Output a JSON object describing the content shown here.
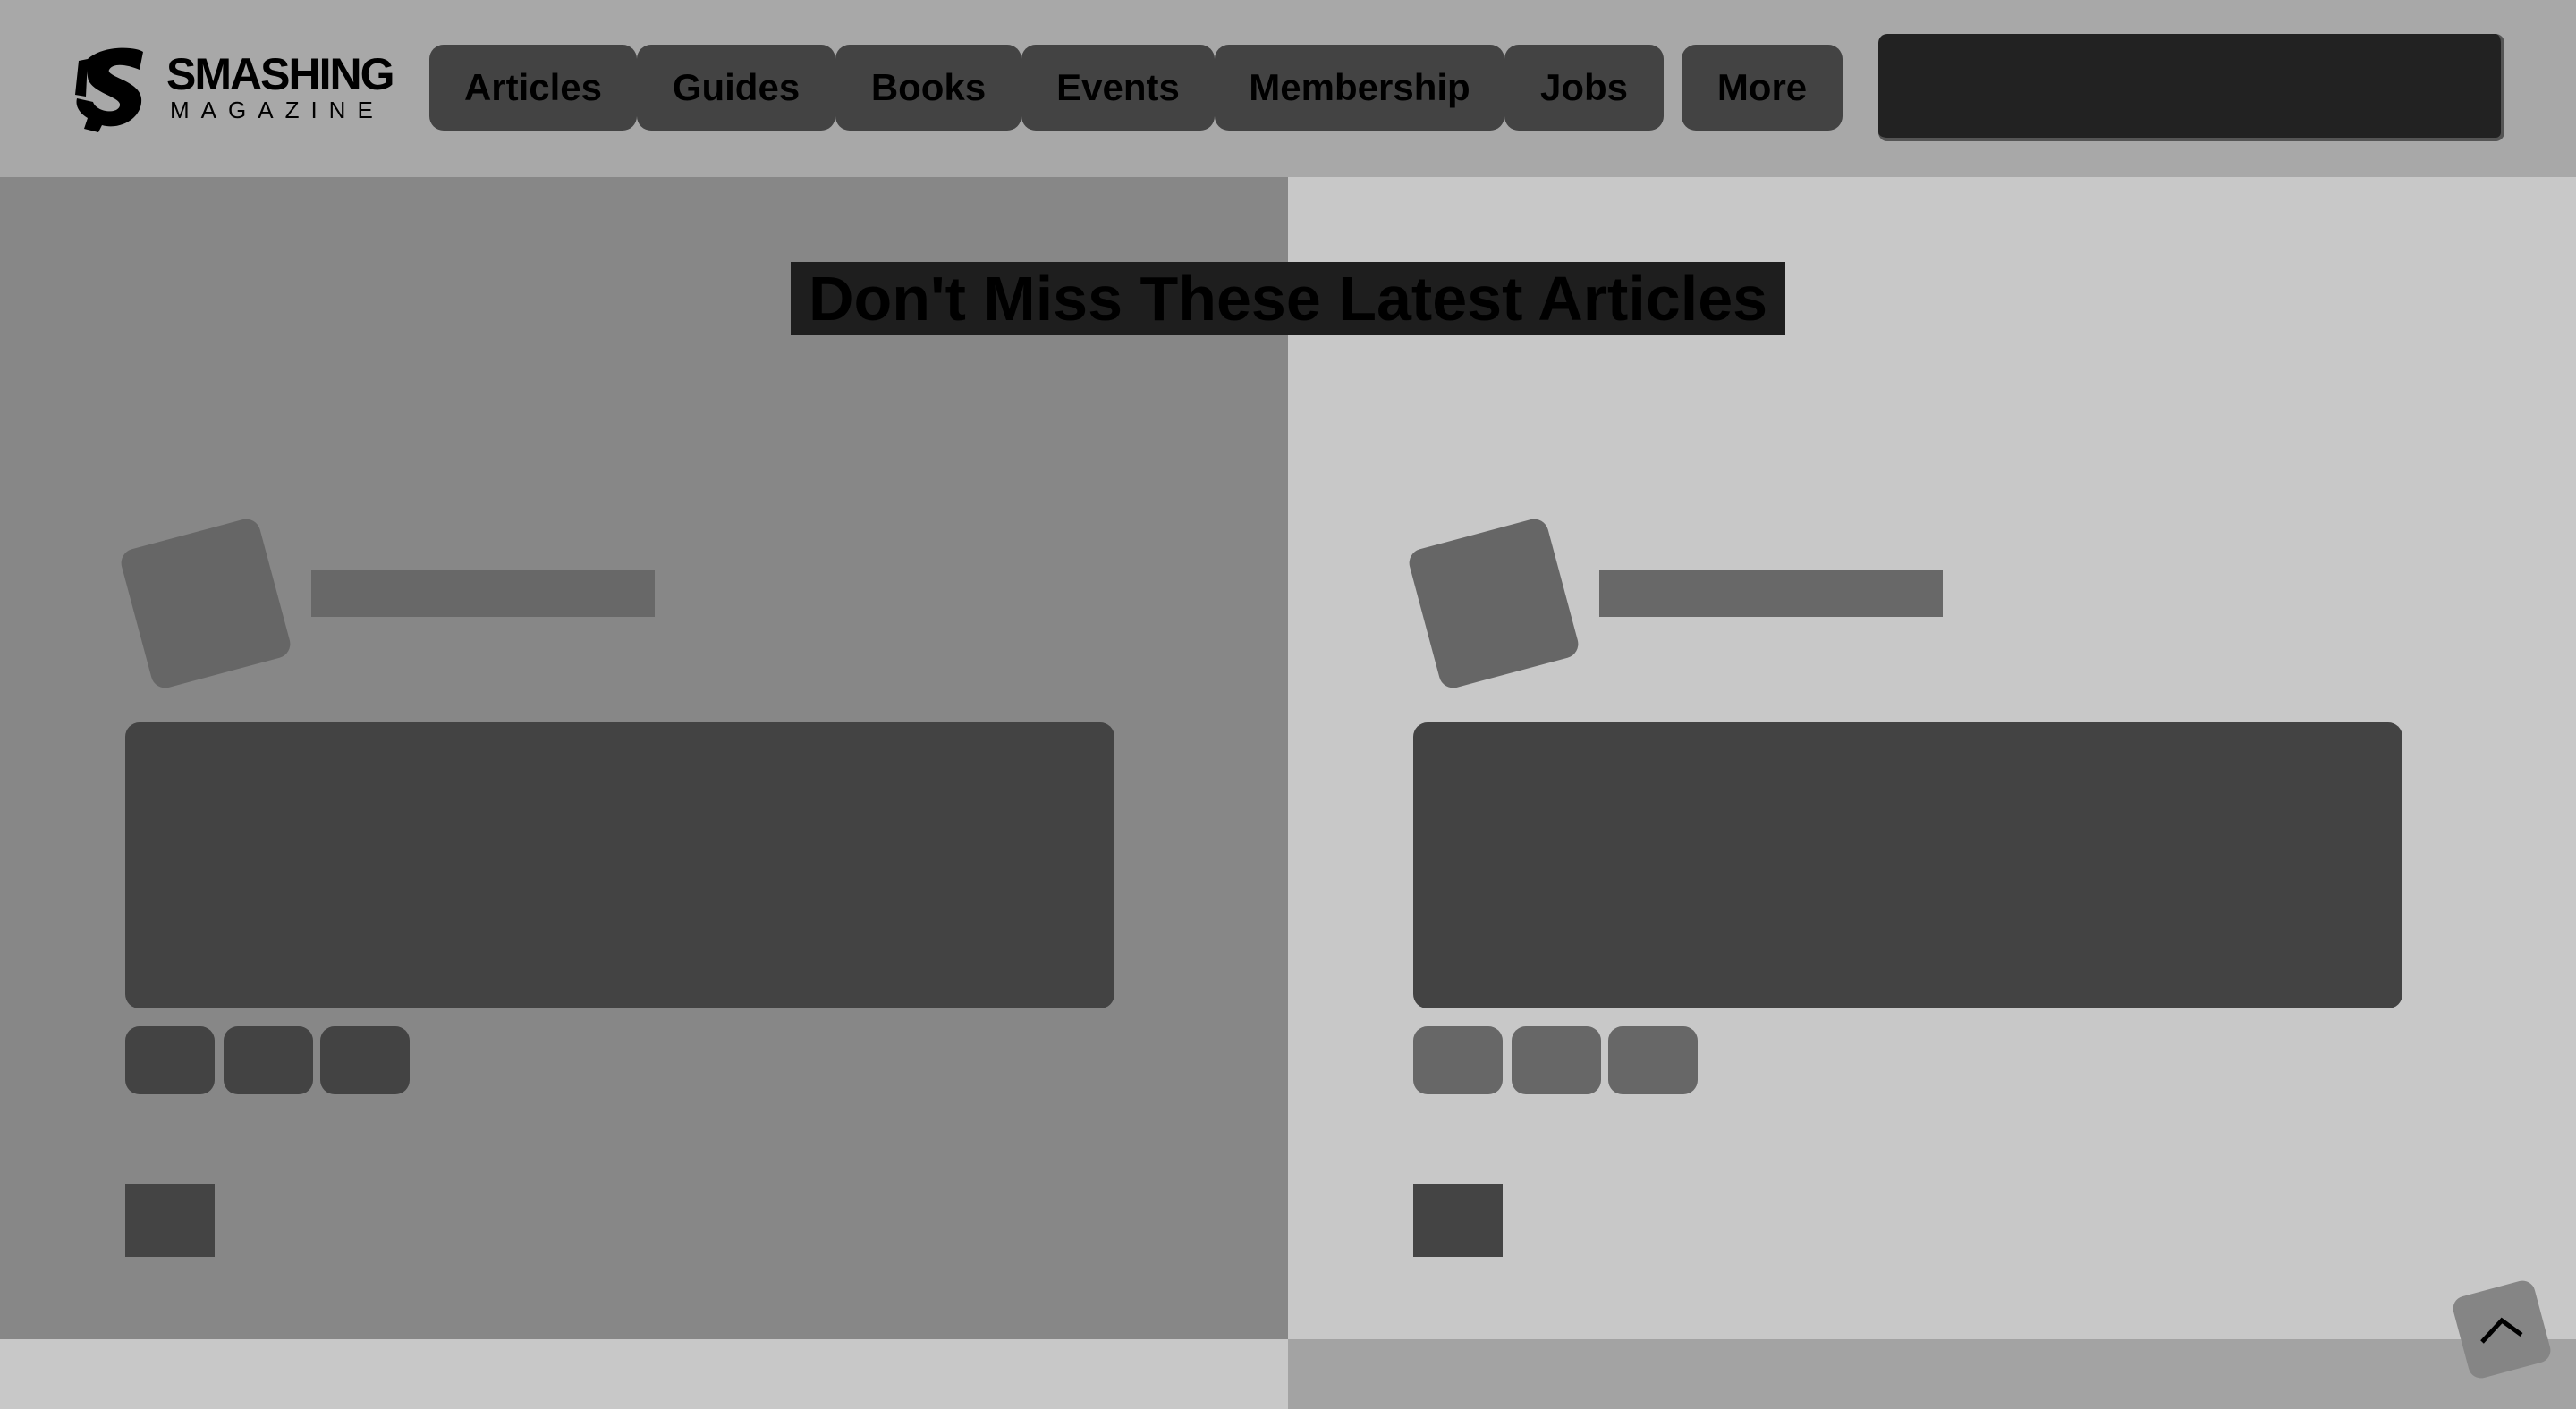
{
  "logo": {
    "wordmark": "SMASHING",
    "subtitle": "MAGAZINE"
  },
  "nav": {
    "items": [
      {
        "label": "Articles"
      },
      {
        "label": "Guides"
      },
      {
        "label": "Books"
      },
      {
        "label": "Events"
      },
      {
        "label": "Membership"
      },
      {
        "label": "Jobs"
      }
    ],
    "more_label": "More"
  },
  "search": {
    "value": ""
  },
  "section": {
    "title": "Don't Miss These Latest Articles"
  },
  "colors": {
    "header_bg": "#a8a8a8",
    "left_column_bg": "#878787",
    "right_column_bg": "#c8c8c8",
    "nav_button_bg": "#434343",
    "search_bg": "#222222",
    "title_highlight": "#1e1e1e",
    "placeholder_dark": "#434343",
    "placeholder_mid": "#666666"
  },
  "icons": {
    "logo": "smashing-cat-icon",
    "back_to_top": "chevron-up-icon"
  }
}
